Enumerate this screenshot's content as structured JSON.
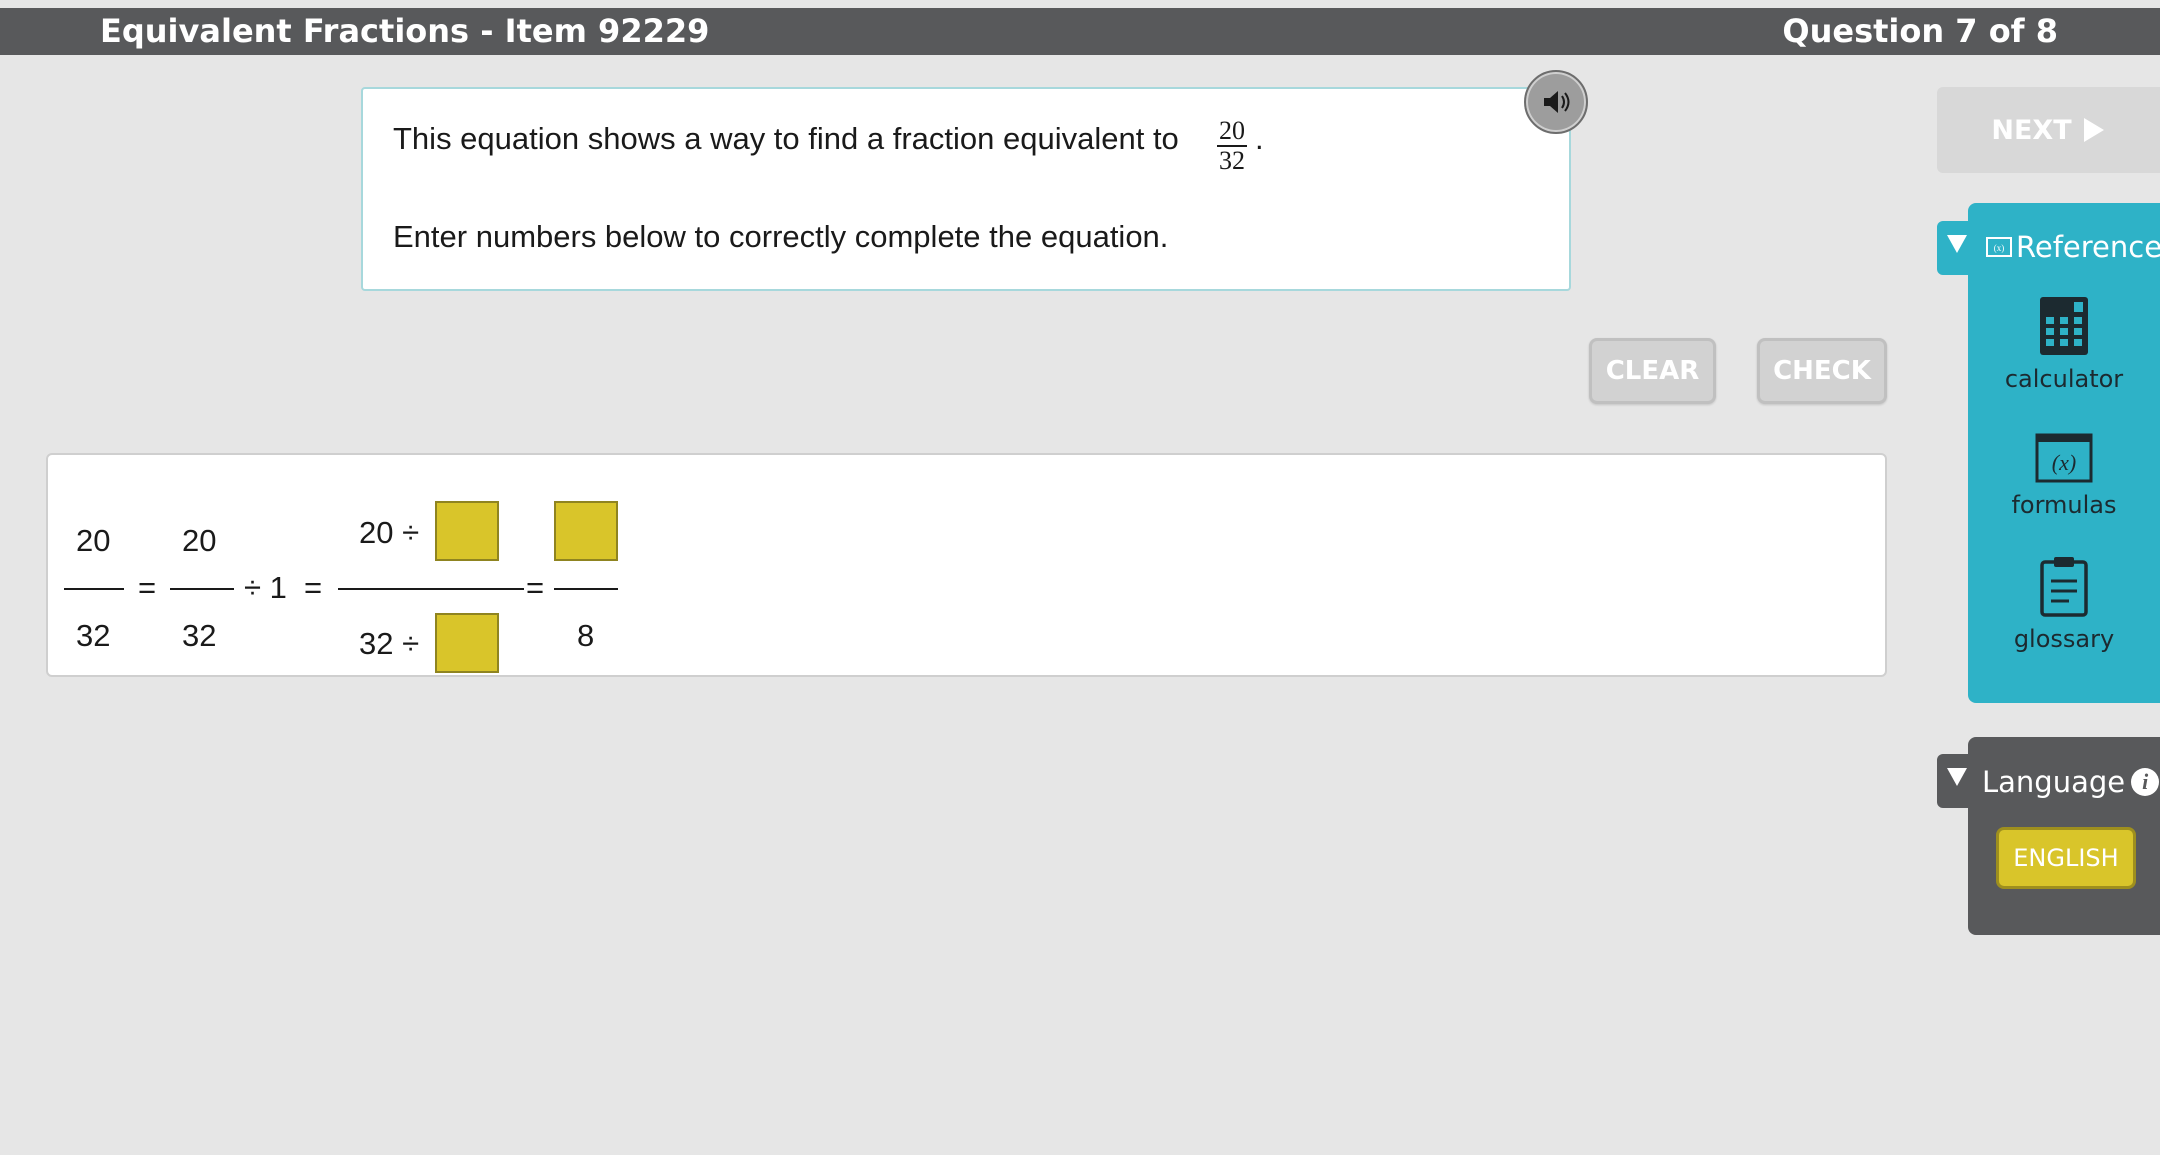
{
  "header": {
    "title": "Equivalent Fractions - Item 92229",
    "question_count": "Question 7 of 8"
  },
  "prompt": {
    "line1": "This equation shows a way to find a fraction equivalent to",
    "fraction_numerator": "20",
    "fraction_denominator": "32",
    "line1_end": ".",
    "line2": "Enter numbers below to correctly complete the equation."
  },
  "buttons": {
    "clear": "CLEAR",
    "check": "CHECK",
    "next": "NEXT"
  },
  "equation": {
    "frac1_num": "20",
    "frac1_den": "32",
    "eq1": "=",
    "frac2_num": "20",
    "frac2_den": "32",
    "div_one": "÷ 1",
    "eq2": "=",
    "frac3_num": "20 ÷",
    "frac3_den": "32 ÷",
    "eq3": "=",
    "frac4_den": "8",
    "answer_boxes": [
      "",
      "",
      ""
    ]
  },
  "sidebar": {
    "reference": {
      "title": "Reference",
      "tools": [
        {
          "label": "calculator",
          "icon": "calculator-icon"
        },
        {
          "label": "formulas",
          "icon": "formulas-icon"
        },
        {
          "label": "glossary",
          "icon": "clipboard-icon"
        }
      ]
    },
    "language": {
      "title": "Language",
      "selected": "ENGLISH"
    }
  },
  "colors": {
    "header_bg": "#58595b",
    "reference_bg": "#2eb2c7",
    "answer_box": "#d9c52a",
    "prompt_border": "#a7d8dc"
  }
}
